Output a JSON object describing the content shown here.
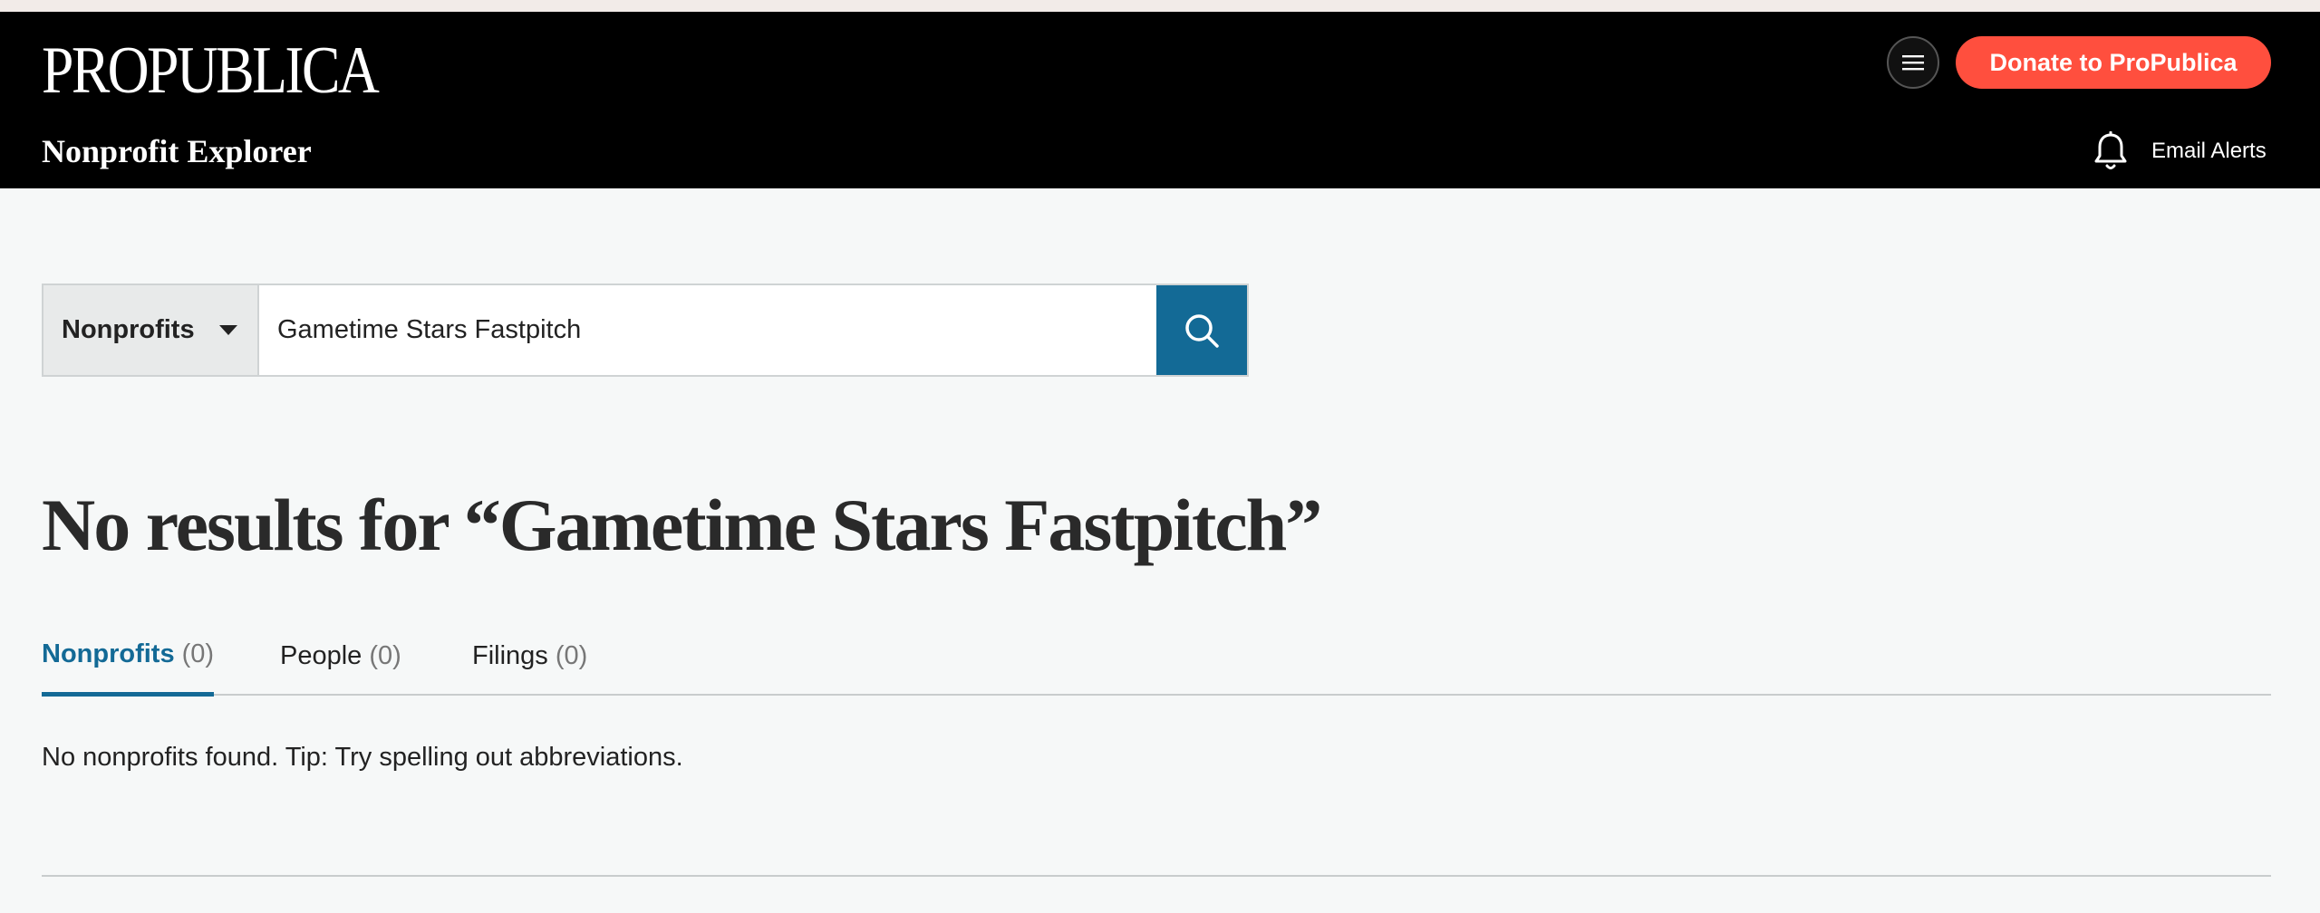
{
  "header": {
    "logo": "PROPUBLICA",
    "subbrand": "Nonprofit Explorer",
    "donate_label": "Donate to ProPublica",
    "email_alerts_label": "Email Alerts",
    "menu_icon": "hamburger-icon",
    "bell_icon": "bell-icon"
  },
  "search": {
    "category": "Nonprofits",
    "query": "Gametime Stars Fastpitch",
    "search_icon": "search-icon"
  },
  "results": {
    "heading": "No results for “Gametime Stars Fastpitch”",
    "tabs": [
      {
        "label": "Nonprofits",
        "count": "(0)",
        "active": true
      },
      {
        "label": "People",
        "count": "(0)",
        "active": false
      },
      {
        "label": "Filings",
        "count": "(0)",
        "active": false
      }
    ],
    "message": "No nonprofits found. Tip: Try spelling out abbreviations."
  },
  "colors": {
    "header_bg": "#000000",
    "donate": "#ff4f3e",
    "accent": "#136a96",
    "page_bg": "#f6f8f8"
  }
}
